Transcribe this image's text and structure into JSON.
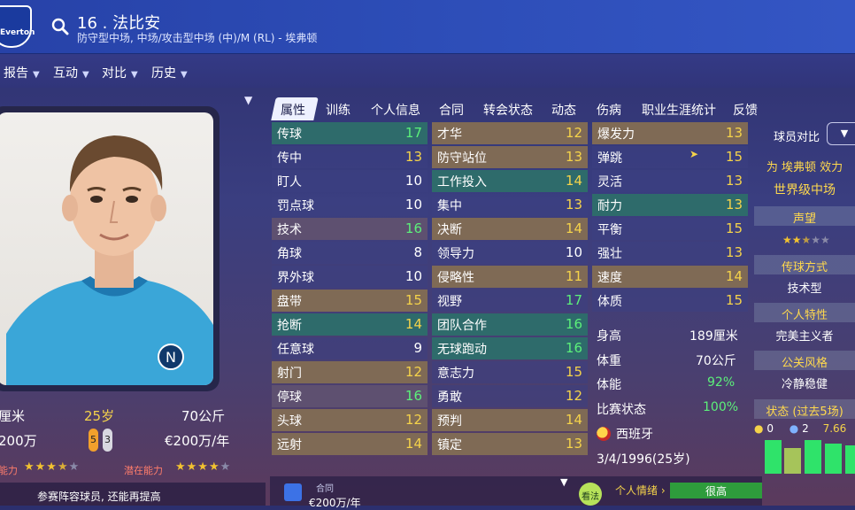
{
  "header": {
    "club_name": "Everton",
    "title": "16 . 法比安",
    "subtitle": "防守型中场, 中场/攻击型中场 (中)/M (RL) - 埃弗顿"
  },
  "menu": [
    {
      "label": "报告"
    },
    {
      "label": "互动"
    },
    {
      "label": "对比"
    },
    {
      "label": "历史"
    }
  ],
  "profile": {
    "height": "厘米",
    "age": "25岁",
    "weight": "70公斤",
    "value": "200万",
    "left_foot": "5",
    "right_foot": "3",
    "wage": "€200万/年",
    "current_ability_label": "能力",
    "potential_ability_label": "潜在能力",
    "current_ability_stars": 3.5,
    "potential_ability_stars": 4,
    "squad_status": "参赛阵容球员, 还能再提高"
  },
  "tabs": [
    "属性",
    "训练",
    "个人信息",
    "合同",
    "转会状态",
    "动态",
    "伤病",
    "职业生涯统计",
    "反馈"
  ],
  "attributes": {
    "technical": [
      {
        "name": "传球",
        "value": "17"
      },
      {
        "name": "传中",
        "value": "13"
      },
      {
        "name": "盯人",
        "value": "10"
      },
      {
        "name": "罚点球",
        "value": "10"
      },
      {
        "name": "技术",
        "value": "16"
      },
      {
        "name": "角球",
        "value": "8"
      },
      {
        "name": "界外球",
        "value": "10"
      },
      {
        "name": "盘带",
        "value": "15"
      },
      {
        "name": "抢断",
        "value": "14"
      },
      {
        "name": "任意球",
        "value": "9"
      },
      {
        "name": "射门",
        "value": "12"
      },
      {
        "name": "停球",
        "value": "16"
      },
      {
        "name": "头球",
        "value": "12"
      },
      {
        "name": "远射",
        "value": "14"
      }
    ],
    "mental": [
      {
        "name": "才华",
        "value": "12"
      },
      {
        "name": "防守站位",
        "value": "13"
      },
      {
        "name": "工作投入",
        "value": "14"
      },
      {
        "name": "集中",
        "value": "13"
      },
      {
        "name": "决断",
        "value": "14"
      },
      {
        "name": "领导力",
        "value": "10"
      },
      {
        "name": "侵略性",
        "value": "11"
      },
      {
        "name": "视野",
        "value": "17"
      },
      {
        "name": "团队合作",
        "value": "16"
      },
      {
        "name": "无球跑动",
        "value": "16"
      },
      {
        "name": "意志力",
        "value": "15"
      },
      {
        "name": "勇敢",
        "value": "12"
      },
      {
        "name": "预判",
        "value": "14"
      },
      {
        "name": "镇定",
        "value": "13"
      }
    ],
    "physical": [
      {
        "name": "爆发力",
        "value": "13"
      },
      {
        "name": "弹跳",
        "value": "15"
      },
      {
        "name": "灵活",
        "value": "13"
      },
      {
        "name": "耐力",
        "value": "13"
      },
      {
        "name": "平衡",
        "value": "15"
      },
      {
        "name": "强壮",
        "value": "13"
      },
      {
        "name": "速度",
        "value": "14"
      },
      {
        "name": "体质",
        "value": "15"
      }
    ]
  },
  "bio": {
    "height_label": "身高",
    "height_value": "189厘米",
    "weight_label": "体重",
    "weight_value": "70公斤",
    "fitness_label": "体能",
    "fitness_value": "92%",
    "match_label": "比赛状态",
    "match_value": "100%",
    "nation": "西班牙",
    "dob": "3/4/1996(25岁)"
  },
  "bottom": {
    "contract_label": "合同",
    "contract_value": "€200万/年",
    "advice_label": "看法",
    "mood_label": "个人情绪",
    "mood_value": "很高"
  },
  "right": {
    "compare_label": "球员对比",
    "effect_for": "为 埃弗顿 效力",
    "level": "世界级中场",
    "rep_header": "声望",
    "rep_stars": 2.5,
    "style_header": "传球方式",
    "style_value": "技术型",
    "trait_header": "个人特性",
    "trait_value": "完美主义者",
    "media_header": "公关风格",
    "media_value": "冷静稳健",
    "form_header": "状态 (过去5场)",
    "form_goals": "0",
    "form_assists": "2",
    "form_rating": "7.66"
  },
  "colors": {
    "header_blue": "#2d4db7",
    "value_green": "#5cf07a",
    "value_yellow": "#f5d34a",
    "star_gold": "#f2c230",
    "section_gold": "#ffd94d"
  }
}
